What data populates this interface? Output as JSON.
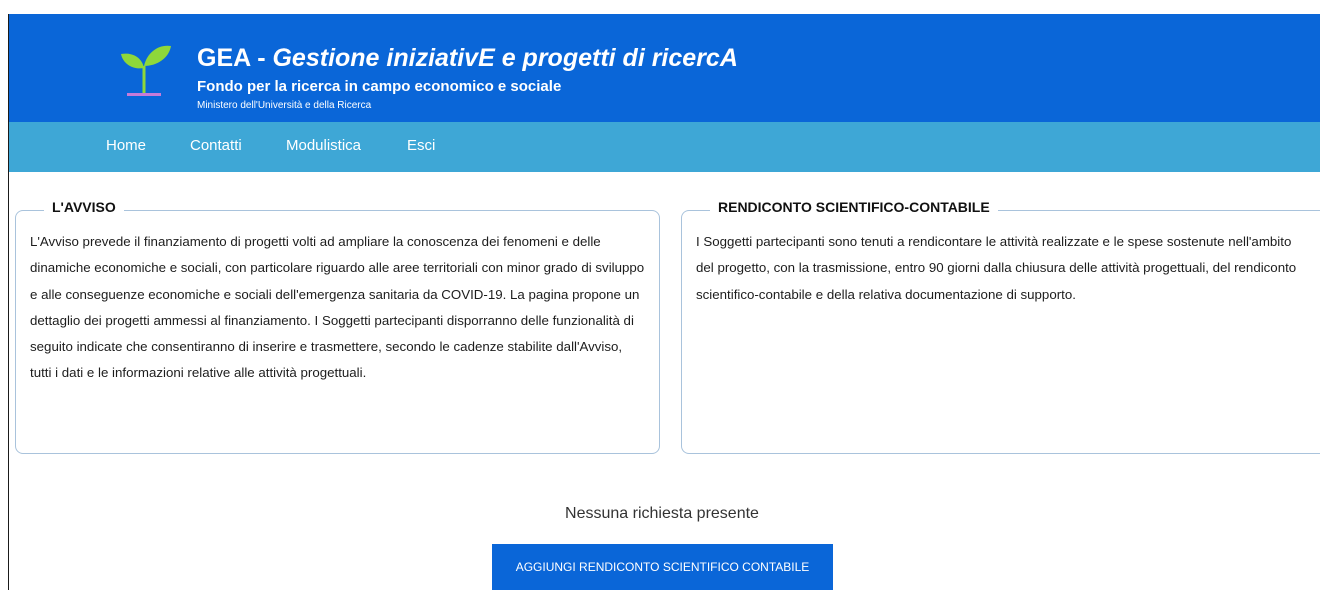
{
  "header": {
    "brand_prefix": "GEA -",
    "brand_italic": "Gestione iniziativE e progetti di ricercA",
    "subtitle": "Fondo per la ricerca in campo economico e sociale",
    "ministry": "Ministero dell'Università e della Ricerca",
    "logo_icon": "sprout-icon",
    "colors": {
      "header_bg": "#0a66d8",
      "nav_bg": "#3ea7d6",
      "logo_leaf": "#8ed83a",
      "logo_base": "#c77bd9"
    }
  },
  "nav": {
    "items": [
      {
        "label": "Home"
      },
      {
        "label": "Contatti"
      },
      {
        "label": "Modulistica"
      },
      {
        "label": "Esci"
      }
    ]
  },
  "avviso": {
    "title": "L'AVVISO",
    "text": "L'Avviso prevede il finanziamento di progetti volti ad ampliare la conoscenza dei fenomeni e delle dinamiche economiche e sociali, con particolare riguardo alle aree territoriali con minor grado di sviluppo e alle conseguenze economiche e sociali dell'emergenza sanitaria da COVID-19. La pagina propone un dettaglio dei progetti ammessi al finanziamento. I Soggetti partecipanti disporranno delle funzionalità di seguito indicate che consentiranno di inserire e trasmettere, secondo le cadenze stabilite dall'Avviso, tutti i dati e le informazioni relative alle attività progettuali."
  },
  "rendiconto": {
    "title": "RENDICONTO SCIENTIFICO-CONTABILE",
    "text": "I Soggetti partecipanti sono tenuti a rendicontare le attività realizzate e le spese sostenute nell'ambito del progetto, con la trasmissione, entro 90 giorni dalla chiusura delle attività progettuali, del rendiconto scientifico-contabile e della relativa documentazione di supporto."
  },
  "main": {
    "empty_message": "Nessuna richiesta presente",
    "add_button_label": "AGGIUNGI RENDICONTO SCIENTIFICO CONTABILE"
  }
}
